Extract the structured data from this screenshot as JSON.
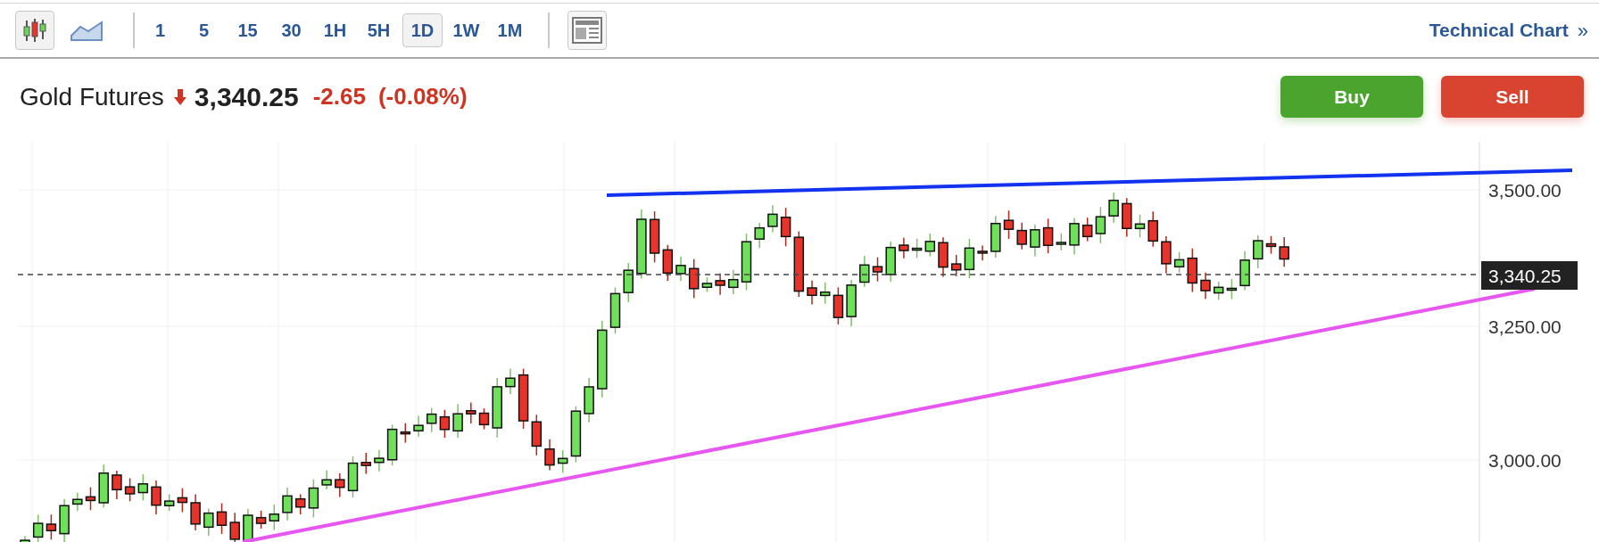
{
  "toolbar": {
    "chart_types": [
      {
        "kind": "candlestick",
        "selected": true
      },
      {
        "kind": "area",
        "selected": false
      }
    ],
    "intervals": [
      {
        "label": "1",
        "selected": false
      },
      {
        "label": "5",
        "selected": false
      },
      {
        "label": "15",
        "selected": false
      },
      {
        "label": "30",
        "selected": false
      },
      {
        "label": "1H",
        "selected": false
      },
      {
        "label": "5H",
        "selected": false
      },
      {
        "label": "1D",
        "selected": true
      },
      {
        "label": "1W",
        "selected": false
      },
      {
        "label": "1M",
        "selected": false
      }
    ],
    "technical_chart_link": {
      "label": "Technical Chart",
      "icon": "»"
    }
  },
  "quote": {
    "instrument": "Gold Futures",
    "falling": true,
    "price": "3,340.25",
    "change": "-2.65",
    "change_percent": "(-0.08%)"
  },
  "buttons": [
    {
      "kind": "buy",
      "label": "Buy"
    },
    {
      "kind": "sell",
      "label": "Sell"
    }
  ],
  "price_axis": {
    "labels": [
      "3,500.00",
      "3,250.00",
      "3,000.00"
    ],
    "current_price_tag": "3,340.25"
  }
}
